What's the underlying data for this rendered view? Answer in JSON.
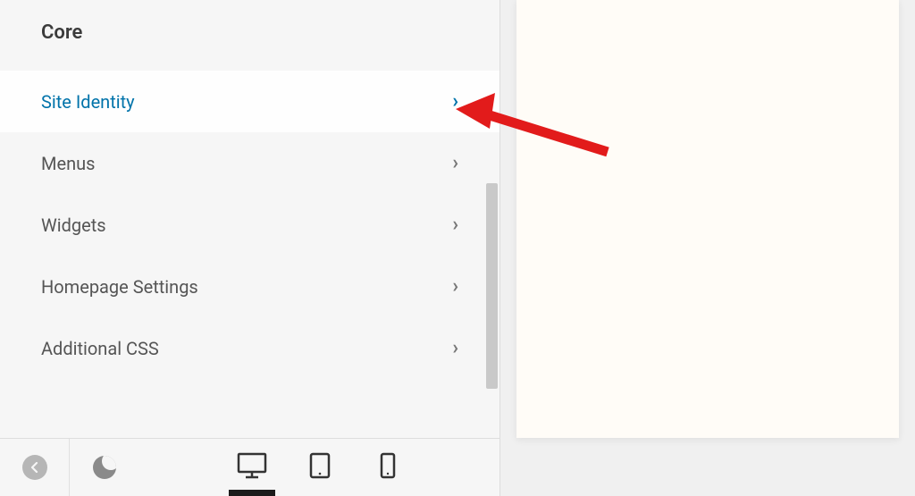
{
  "sidebar": {
    "section_title": "Core",
    "items": [
      {
        "label": "Site Identity",
        "active": true
      },
      {
        "label": "Menus",
        "active": false
      },
      {
        "label": "Widgets",
        "active": false
      },
      {
        "label": "Homepage Settings",
        "active": false
      },
      {
        "label": "Additional CSS",
        "active": false
      }
    ]
  },
  "toolbar": {
    "collapse_label": "Collapse",
    "darkmode_label": "Dark mode",
    "device_desktop": "Desktop",
    "device_tablet": "Tablet",
    "device_mobile": "Mobile"
  },
  "annotation": {
    "arrow_color": "#e21b1b"
  }
}
